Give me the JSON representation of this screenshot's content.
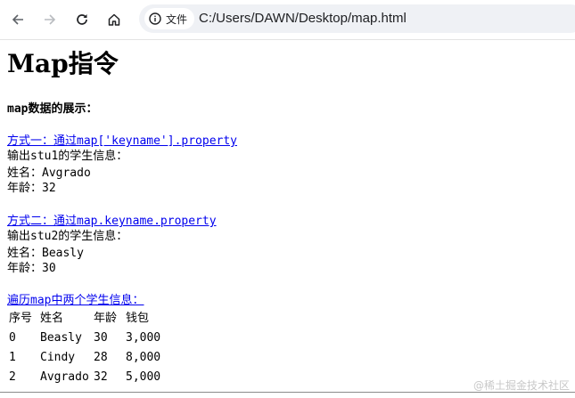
{
  "browser": {
    "site_info_label": "文件",
    "url": "C:/Users/DAWN/Desktop/map.html",
    "icons": {
      "back": "arrow-left-icon",
      "forward": "arrow-right-icon",
      "reload": "reload-icon",
      "home": "home-icon",
      "site_info": "info-icon"
    }
  },
  "page": {
    "title": "Map指令",
    "subtitle": "map数据的展示：",
    "section1": {
      "link": "方式一：通过map['keyname'].property",
      "heading": "输出stu1的学生信息：",
      "name_line": "姓名：Avgrado",
      "age_line": "年龄：32"
    },
    "section2": {
      "link": "方式二：通过map.keyname.property",
      "heading": "输出stu2的学生信息：",
      "name_line": "姓名：Beasly",
      "age_line": "年龄：30"
    },
    "section3": {
      "link": "遍历map中两个学生信息："
    },
    "table": {
      "headers": [
        "序号",
        "姓名",
        "年龄",
        "钱包"
      ],
      "rows": [
        [
          "0",
          "Beasly",
          "30",
          "3,000"
        ],
        [
          "1",
          "Cindy",
          "28",
          "8,000"
        ],
        [
          "2",
          "Avgrado",
          "32",
          "5,000"
        ]
      ]
    }
  },
  "watermark": "@稀土掘金技术社区",
  "colors": {
    "link": "#0000ee",
    "omnibox_bg": "#eff1f5",
    "icon": "#5f6368"
  }
}
